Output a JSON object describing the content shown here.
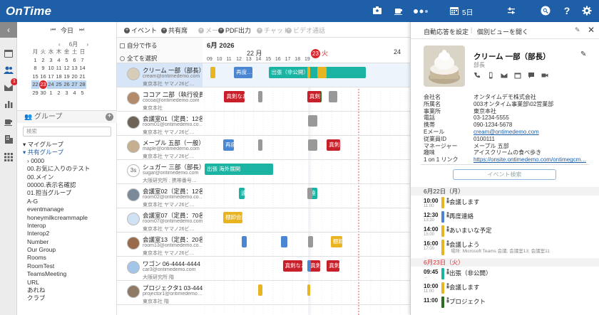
{
  "header": {
    "app_name": "OnTime",
    "view_label": "5日",
    "colors": {
      "brand": "#1f5fa8"
    }
  },
  "rail": {
    "icons": [
      "calendar-icon",
      "people-icon",
      "mail-icon",
      "chart-icon",
      "coffee-icon",
      "building-icon",
      "grid-icon"
    ],
    "mail_badge": "1"
  },
  "nav": {
    "today": "今日",
    "prev": "⏮",
    "next": "⏭"
  },
  "mini_calendar": {
    "month": "6月",
    "weekdays": [
      "月",
      "火",
      "水",
      "木",
      "金",
      "土",
      "日"
    ],
    "weeks": [
      [
        "1",
        "2",
        "3",
        "4",
        "5",
        "6",
        "7"
      ],
      [
        "8",
        "9",
        "10",
        "11",
        "12",
        "13",
        "14"
      ],
      [
        "15",
        "16",
        "17",
        "18",
        "19",
        "20",
        "21"
      ],
      [
        "22",
        "23",
        "24",
        "25",
        "26",
        "27",
        "28"
      ],
      [
        "29",
        "30",
        "1",
        "2",
        "3",
        "4",
        "5"
      ]
    ],
    "today": "23"
  },
  "groups": {
    "title": "グループ",
    "search_placeholder": "検索",
    "items": [
      {
        "label": "マイグループ",
        "level": 1,
        "blue": false,
        "arrow": "▾"
      },
      {
        "label": "共有グループ",
        "level": 1,
        "blue": true,
        "arrow": "▾"
      },
      {
        "label": "0000",
        "level": 2,
        "blue": false,
        "arrow": "›"
      },
      {
        "label": "00.お気に入りのテスト",
        "level": 2,
        "blue": false,
        "arrow": ""
      },
      {
        "label": "00.メイン",
        "level": 2,
        "blue": false,
        "arrow": ""
      },
      {
        "label": "00000.表示名確認",
        "level": 2,
        "blue": false,
        "arrow": ""
      },
      {
        "label": "01.担当グループ",
        "level": 2,
        "blue": false,
        "arrow": ""
      },
      {
        "label": "A-G",
        "level": 2,
        "blue": false,
        "arrow": ""
      },
      {
        "label": "eventmanage",
        "level": 2,
        "blue": false,
        "arrow": ""
      },
      {
        "label": "honeymilkcreammaple",
        "level": 2,
        "blue": false,
        "arrow": ""
      },
      {
        "label": "Interop",
        "level": 2,
        "blue": false,
        "arrow": ""
      },
      {
        "label": "Interop2",
        "level": 2,
        "blue": false,
        "arrow": ""
      },
      {
        "label": "Number",
        "level": 2,
        "blue": false,
        "arrow": ""
      },
      {
        "label": "Our Group",
        "level": 2,
        "blue": false,
        "arrow": ""
      },
      {
        "label": "Rooms",
        "level": 2,
        "blue": false,
        "arrow": ""
      },
      {
        "label": "RoomTest",
        "level": 2,
        "blue": false,
        "arrow": ""
      },
      {
        "label": "TeamsMeeting",
        "level": 2,
        "blue": false,
        "arrow": ""
      },
      {
        "label": "URL",
        "level": 2,
        "blue": false,
        "arrow": ""
      },
      {
        "label": "あれね",
        "level": 2,
        "blue": false,
        "arrow": ""
      },
      {
        "label": "クラブ",
        "level": 2,
        "blue": false,
        "arrow": ""
      }
    ]
  },
  "toolbar": {
    "self_create": "自分で作る",
    "select_all": "全てを選択",
    "buttons": [
      {
        "label": "イベント",
        "disabled": false
      },
      {
        "label": "共有席",
        "disabled": false
      },
      {
        "label": "メール",
        "disabled": true
      },
      {
        "label": "PDF出力",
        "disabled": false
      },
      {
        "label": "チャット",
        "disabled": true
      },
      {
        "label": "ビデオ通話",
        "disabled": true
      }
    ]
  },
  "timeline": {
    "month_label": "6月 2026",
    "days": [
      {
        "label": "22 月",
        "today": false
      },
      {
        "label": "23 火",
        "today": true
      },
      {
        "label": "24",
        "today": false
      }
    ],
    "hours": [
      "09",
      "10",
      "11",
      "12",
      "13",
      "14",
      "15",
      "16",
      "17",
      "18",
      "19"
    ]
  },
  "people": [
    {
      "name": "クリーム 一部（部長）",
      "email": "cream@ontimedemo.com",
      "office": "東京本社 ヤマノ26ビ…",
      "avatar": "",
      "selected": true
    },
    {
      "name": "ココア 二部（執行役員）",
      "email": "cocoa@ontimedemo.com",
      "office": "東京本社",
      "avatar": "",
      "selected": false
    },
    {
      "name": "会議室01（定員：12名）0…",
      "email": "room01@ontimedemo.co…",
      "office": "東京本社 ヤマノ26ビ…",
      "avatar": "",
      "selected": false
    },
    {
      "name": "メープル 五部（一般）",
      "email": "maple@ontimedemo.com",
      "office": "東京本社 ヤマノ26ビ…",
      "avatar": "",
      "selected": false
    },
    {
      "name": "シュガー 三部（部長）",
      "email": "sugar@ontimedemo.com",
      "office": "大阪研究所 ; 携帯番号…",
      "avatar": "3s",
      "selected": false
    },
    {
      "name": "会議室02（定員：12名）0…",
      "email": "room02@ontimedemo.co…",
      "office": "東京本社 ヤマノ26ビ…",
      "avatar": "",
      "selected": false
    },
    {
      "name": "会議室07（定員：70名）",
      "email": "room07@ontimedemo.com",
      "office": "東京本社 ヤマノ26ビ…",
      "avatar": "",
      "selected": false
    },
    {
      "name": "会議室13（定員：20名）",
      "email": "room13@ontimedemo.co…",
      "office": "東京本社 ヤマノ26ビ…",
      "avatar": "",
      "selected": false
    },
    {
      "name": "ワゴン 06-4444-4444（…",
      "email": "car3@ontimedemo.com",
      "office": "大阪研究所 階",
      "avatar": "",
      "selected": false
    },
    {
      "name": "プロジェクタ1 03-4444…",
      "email": "projector1@ontimedemo…",
      "office": "東京本社 階",
      "avatar": "",
      "selected": false
    }
  ],
  "events": [
    {
      "row": 0,
      "start_hour": 9.1,
      "end_hour": 9.6,
      "label": "",
      "color": "#e8b422"
    },
    {
      "row": 0,
      "start_hour": 11.5,
      "end_hour": 13.4,
      "label": "再度…",
      "color": "#4a86d1"
    },
    {
      "row": 0,
      "start_hour": 15.1,
      "end_hour": 25.0,
      "label": "出張（非公開）",
      "color": "#1bb3a2"
    },
    {
      "row": 0,
      "start_hour": 24.0,
      "end_hour": 24.3,
      "label": "",
      "color": "#e8b422"
    },
    {
      "row": 0,
      "start_hour": 25.0,
      "end_hour": 26.0,
      "label": "",
      "color": "#e8b422"
    },
    {
      "row": 1,
      "start_hour": 10.5,
      "end_hour": 12.6,
      "label": "真剣なお…",
      "color": "#c8202a"
    },
    {
      "row": 1,
      "start_hour": 14.0,
      "end_hour": 14.4,
      "label": "",
      "color": "#999999"
    },
    {
      "row": 1,
      "start_hour": 19.1,
      "end_hour": 20.0,
      "label": "",
      "color": "#e8b422"
    },
    {
      "row": 1,
      "start_hour": 20.2,
      "end_hour": 20.5,
      "label": "",
      "color": "#2a6e1f"
    },
    {
      "row": 1,
      "start_hour": 21.2,
      "end_hour": 22.1,
      "label": "",
      "color": "#999999"
    },
    {
      "row": 1,
      "start_hour": 24.0,
      "end_hour": 25.4,
      "label": "真剣なお…",
      "color": "#c8202a"
    },
    {
      "row": 2,
      "start_hour": 19.1,
      "end_hour": 20.0,
      "label": "",
      "color": "#999999"
    },
    {
      "row": 3,
      "start_hour": 10.4,
      "end_hour": 11.5,
      "label": "再度…",
      "color": "#4a86d1"
    },
    {
      "row": 3,
      "start_hour": 14.0,
      "end_hour": 14.4,
      "label": "",
      "color": "#999999"
    },
    {
      "row": 3,
      "start_hour": 19.1,
      "end_hour": 20.0,
      "label": "",
      "color": "#999999"
    },
    {
      "row": 3,
      "start_hour": 21.2,
      "end_hour": 22.0,
      "label": "",
      "color": "#999999"
    },
    {
      "row": 3,
      "start_hour": 26.0,
      "end_hour": 27.4,
      "label": "真剣なお…",
      "color": "#c8202a"
    },
    {
      "row": 4,
      "start_hour": 8.5,
      "end_hour": 15.5,
      "label": "出張 海外展開",
      "color": "#1bb3a2"
    },
    {
      "row": 5,
      "start_hour": 12.0,
      "end_hour": 12.6,
      "label": "遠",
      "color": "#1bb3a2"
    },
    {
      "row": 5,
      "start_hour": 19.1,
      "end_hour": 20.0,
      "label": "遠",
      "color": "#1bb3a2"
    },
    {
      "row": 5,
      "start_hour": 24.0,
      "end_hour": 24.5,
      "label": "",
      "color": "#999999"
    },
    {
      "row": 6,
      "start_hour": 10.4,
      "end_hour": 12.4,
      "label": "棚卸会議",
      "color": "#e8b422"
    },
    {
      "row": 7,
      "start_hour": 12.3,
      "end_hour": 12.8,
      "label": "",
      "color": "#4a86d1"
    },
    {
      "row": 7,
      "start_hour": 16.3,
      "end_hour": 17.0,
      "label": "",
      "color": "#4a86d1"
    },
    {
      "row": 7,
      "start_hour": 19.1,
      "end_hour": 19.6,
      "label": "",
      "color": "#999999"
    },
    {
      "row": 7,
      "start_hour": 26.4,
      "end_hour": 27.6,
      "label": "棚卸会議",
      "color": "#e8b422"
    },
    {
      "row": 8,
      "start_hour": 16.5,
      "end_hour": 18.5,
      "label": "真剣なお…",
      "color": "#c8202a"
    },
    {
      "row": 8,
      "start_hour": 19.1,
      "end_hour": 20.3,
      "label": "真剣なお…",
      "color": "#c8202a"
    },
    {
      "row": 8,
      "start_hour": 24.0,
      "end_hour": 24.4,
      "label": "",
      "color": "#4a86d1"
    },
    {
      "row": 8,
      "start_hour": 26.0,
      "end_hour": 27.3,
      "label": "真剣なお…",
      "color": "#c8202a"
    },
    {
      "row": 9,
      "start_hour": 14.0,
      "end_hour": 14.4,
      "label": "",
      "color": "#e8b422"
    },
    {
      "row": 9,
      "start_hour": 24.0,
      "end_hour": 24.3,
      "label": "",
      "color": "#e8b422"
    }
  ],
  "detail": {
    "auto_reply": "自動応答を設定",
    "open_view": "個別ビューを開く",
    "name": "クリーム 一部（部長）",
    "dept": "部長",
    "info": [
      {
        "key": "会社名",
        "value": "オンタイムデモ株式会社",
        "link": false
      },
      {
        "key": "所属名",
        "value": "003オンタイム事業部\\02営業部",
        "link": false
      },
      {
        "key": "事業所",
        "value": "東京本社",
        "link": false
      },
      {
        "key": "電話",
        "value": "03-1234-5555",
        "link": false
      },
      {
        "key": "携帯",
        "value": "090-1234-5678",
        "link": false
      },
      {
        "key": "Eメール",
        "value": "cream@ontimedemo.com",
        "link": true
      },
      {
        "key": "従業員ID",
        "value": "0100111",
        "link": false
      },
      {
        "key": "マネージャー",
        "value": "メープル 五部",
        "link": false
      },
      {
        "key": "趣味",
        "value": "アイスクリームの食べ歩き",
        "link": false
      },
      {
        "key": "1 on 1 リンク",
        "value": "https://onsite.ontimedemo.com/ontimegcm…",
        "link": true
      }
    ],
    "event_search_placeholder": "イベント検索",
    "agenda": [
      {
        "date": "6月22日（月）",
        "red": false,
        "items": [
          {
            "time": "10:00",
            "end": "11:00",
            "title": "会議します",
            "loc": "",
            "color": "#e8b422"
          },
          {
            "time": "12:30",
            "end": "13:30",
            "title": "再度連絡",
            "loc": "",
            "color": "#4a86d1"
          },
          {
            "time": "14:00",
            "end": "15:00",
            "title": "あいまいな予定",
            "loc": "",
            "color": "#e8b422"
          },
          {
            "time": "16:00",
            "end": "17:00",
            "title": "会議しよう",
            "loc": "場所: Microsoft Teams 会議; 会議室13; 会議室11",
            "color": "#e8b422"
          }
        ]
      },
      {
        "date": "6月23日（火）",
        "red": true,
        "items": [
          {
            "time": "09:45",
            "end": "→",
            "title": "出張（非公開）",
            "loc": "",
            "color": "#1bb3a2"
          },
          {
            "time": "10:00",
            "end": "11:00",
            "title": "会議します",
            "loc": "",
            "color": "#e8b422"
          },
          {
            "time": "11:00",
            "end": "",
            "title": "プロジェクト",
            "loc": "",
            "color": "#2a6e1f"
          }
        ]
      }
    ]
  }
}
